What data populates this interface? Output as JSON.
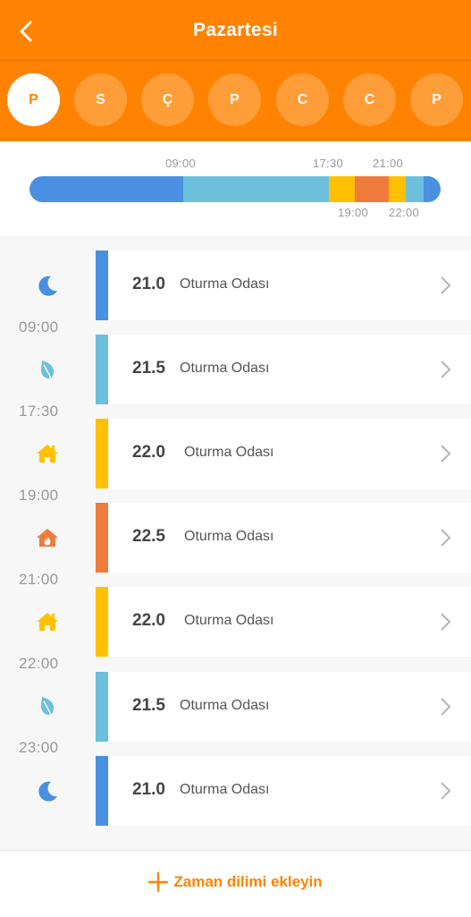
{
  "header": {
    "title": "Pazartesi",
    "back_icon": "chevron-left-icon"
  },
  "days": [
    {
      "label": "P",
      "active": true
    },
    {
      "label": "S",
      "active": false
    },
    {
      "label": "Ç",
      "active": false
    },
    {
      "label": "P",
      "active": false
    },
    {
      "label": "C",
      "active": false
    },
    {
      "label": "C",
      "active": false
    },
    {
      "label": "P",
      "active": false
    }
  ],
  "timeline": {
    "top_labels": [
      "09:00",
      "17:30",
      "21:00"
    ],
    "bottom_labels": [
      "19:00",
      "22:00"
    ]
  },
  "schedule": [
    {
      "temp": "21.0",
      "room": "Oturma Odası",
      "icon": "moon-icon",
      "color": "#4a90e2"
    },
    {
      "temp": "21.5",
      "room": "Oturma Odası",
      "icon": "leaf-icon",
      "color": "#6cc0db"
    },
    {
      "temp": "22.0",
      "room": "Oturma Odası",
      "icon": "home-icon",
      "color": "#ffc000"
    },
    {
      "temp": "22.5",
      "room": "Oturma Odası",
      "icon": "home-fire-icon",
      "color": "#ef7c3c"
    },
    {
      "temp": "22.0",
      "room": "Oturma Odası",
      "icon": "home-icon",
      "color": "#ffc000"
    },
    {
      "temp": "21.5",
      "room": "Oturma Odası",
      "icon": "leaf-icon",
      "color": "#6cc0db"
    },
    {
      "temp": "21.0",
      "room": "Oturma Odası",
      "icon": "moon-icon",
      "color": "#4a90e2"
    }
  ],
  "times": [
    "09:00",
    "17:30",
    "19:00",
    "21:00",
    "22:00",
    "23:00"
  ],
  "footer": {
    "add_label": "Zaman dilimi ekleyin",
    "add_icon": "plus-icon"
  },
  "colors": {
    "brand": "#ff8200",
    "sleep": "#4a90e2",
    "eco": "#6cc0db",
    "comfort": "#ffc000",
    "heat": "#ef7c3c"
  }
}
